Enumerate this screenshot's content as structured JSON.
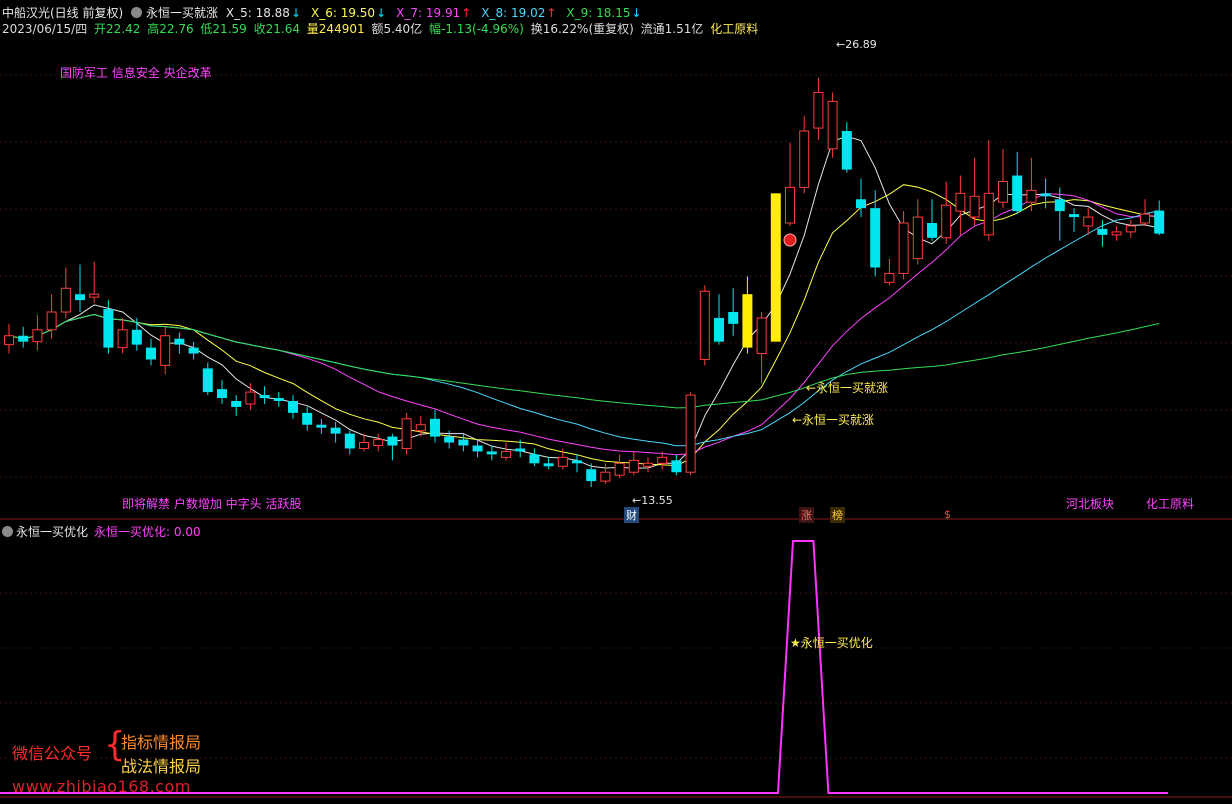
{
  "header": {
    "stock_title": "中船汉光(日线 前复权)",
    "indicator_name": "永恒一买就涨",
    "ma_items": [
      {
        "label": "X_5: 18.88",
        "arrow": "↓",
        "color": "#e6e6e6",
        "arrow_color": "#00e5ff"
      },
      {
        "label": "X_6: 19.50",
        "arrow": "↓",
        "color": "#ffff4a",
        "arrow_color": "#00e5ff"
      },
      {
        "label": "X_7: 19.91",
        "arrow": "↑",
        "color": "#ff44ff",
        "arrow_color": "#ff3030"
      },
      {
        "label": "X_8: 19.02",
        "arrow": "↑",
        "color": "#4ad8ff",
        "arrow_color": "#ff3030"
      },
      {
        "label": "X_9: 18.15",
        "arrow": "↓",
        "color": "#33dd55",
        "arrow_color": "#00e5ff"
      }
    ]
  },
  "quote": {
    "date": "2023/06/15/四",
    "open": "开22.42",
    "high": "高22.76",
    "low": "低21.59",
    "close": "收21.64",
    "volume": "量244901",
    "amount": "额5.40亿",
    "change": "幅-1.13(-4.96%)",
    "turnover": "换16.22%(重复权)",
    "float": "流通1.51亿",
    "industry": "化工原料"
  },
  "annotations": {
    "concept_top": "国防军工 信息安全 央企改革",
    "concept_bottom": "即将解禁 户数增加 中字头 活跃股",
    "region_tag": "河北板块",
    "industry_tag": "化工原料",
    "high_label": "26.89",
    "low_label": "13.55",
    "signal_1": "←永恒一买就涨",
    "signal_2": "←永恒一买就涨",
    "event_cai": "财",
    "event_zhang": "涨",
    "event_bang": "榜",
    "event_s": "$"
  },
  "sub_panel": {
    "title": "永恒一买优化",
    "value_label": "永恒一买优化: 0.00",
    "signal_text": "★永恒一买优化"
  },
  "watermark": {
    "wechat": "微信公众号",
    "line1": "指标情报局",
    "line2": "战法情报局",
    "url": "www.zhibiao168.com"
  },
  "colors": {
    "up": "#ff3d3d",
    "down": "#00e5ee",
    "limit_up": "#ffee00",
    "ma5": "#e6e6e6",
    "ma6": "#ffff4a",
    "ma7": "#ff44ff",
    "ma8": "#4ad8ff",
    "ma9": "#33dd55",
    "sub_line": "#ff33ff"
  },
  "chart_data": {
    "type": "candlestick",
    "price_range": [
      13.0,
      28.0
    ],
    "high": 26.89,
    "low": 13.55,
    "candles": [
      {
        "o": 17.9,
        "c": 18.2,
        "h": 18.6,
        "l": 17.6
      },
      {
        "o": 18.2,
        "c": 18.0,
        "h": 18.5,
        "l": 17.8
      },
      {
        "o": 18.0,
        "c": 18.4,
        "h": 18.9,
        "l": 17.7
      },
      {
        "o": 18.4,
        "c": 19.0,
        "h": 19.6,
        "l": 18.1
      },
      {
        "o": 19.0,
        "c": 19.8,
        "h": 20.5,
        "l": 18.8
      },
      {
        "o": 19.6,
        "c": 19.4,
        "h": 20.6,
        "l": 19.0
      },
      {
        "o": 19.5,
        "c": 19.6,
        "h": 20.7,
        "l": 19.3
      },
      {
        "o": 19.1,
        "c": 17.8,
        "h": 19.4,
        "l": 17.6
      },
      {
        "o": 17.8,
        "c": 18.4,
        "h": 18.8,
        "l": 17.6
      },
      {
        "o": 18.4,
        "c": 17.9,
        "h": 18.8,
        "l": 17.7
      },
      {
        "o": 17.8,
        "c": 17.4,
        "h": 18.1,
        "l": 17.2
      },
      {
        "o": 17.2,
        "c": 18.2,
        "h": 18.5,
        "l": 16.9
      },
      {
        "o": 18.1,
        "c": 17.9,
        "h": 18.3,
        "l": 17.6
      },
      {
        "o": 17.8,
        "c": 17.6,
        "h": 18.0,
        "l": 17.4
      },
      {
        "o": 17.1,
        "c": 16.3,
        "h": 17.3,
        "l": 16.2
      },
      {
        "o": 16.4,
        "c": 16.1,
        "h": 16.7,
        "l": 15.9
      },
      {
        "o": 16.0,
        "c": 15.8,
        "h": 16.2,
        "l": 15.5
      },
      {
        "o": 15.9,
        "c": 16.3,
        "h": 16.6,
        "l": 15.7
      },
      {
        "o": 16.2,
        "c": 16.1,
        "h": 16.5,
        "l": 15.9
      },
      {
        "o": 16.1,
        "c": 16.0,
        "h": 16.3,
        "l": 15.8
      },
      {
        "o": 16.0,
        "c": 15.6,
        "h": 16.2,
        "l": 15.4
      },
      {
        "o": 15.6,
        "c": 15.2,
        "h": 15.8,
        "l": 15.0
      },
      {
        "o": 15.2,
        "c": 15.1,
        "h": 15.4,
        "l": 14.9
      },
      {
        "o": 15.1,
        "c": 14.9,
        "h": 15.3,
        "l": 14.6
      },
      {
        "o": 14.9,
        "c": 14.4,
        "h": 15.0,
        "l": 14.2
      },
      {
        "o": 14.4,
        "c": 14.6,
        "h": 14.9,
        "l": 14.3
      },
      {
        "o": 14.5,
        "c": 14.7,
        "h": 14.9,
        "l": 14.3
      },
      {
        "o": 14.8,
        "c": 14.5,
        "h": 14.9,
        "l": 14.0
      },
      {
        "o": 14.4,
        "c": 15.4,
        "h": 15.6,
        "l": 14.2
      },
      {
        "o": 15.0,
        "c": 15.2,
        "h": 15.5,
        "l": 14.8
      },
      {
        "o": 15.4,
        "c": 14.8,
        "h": 15.7,
        "l": 14.6
      },
      {
        "o": 14.8,
        "c": 14.6,
        "h": 15.0,
        "l": 14.4
      },
      {
        "o": 14.7,
        "c": 14.5,
        "h": 14.9,
        "l": 14.3
      },
      {
        "o": 14.5,
        "c": 14.3,
        "h": 14.7,
        "l": 14.1
      },
      {
        "o": 14.3,
        "c": 14.2,
        "h": 14.5,
        "l": 14.0
      },
      {
        "o": 14.1,
        "c": 14.3,
        "h": 14.6,
        "l": 14.0
      },
      {
        "o": 14.4,
        "c": 14.3,
        "h": 14.7,
        "l": 14.1
      },
      {
        "o": 14.2,
        "c": 13.9,
        "h": 14.4,
        "l": 13.8
      },
      {
        "o": 13.9,
        "c": 13.8,
        "h": 14.1,
        "l": 13.7
      },
      {
        "o": 13.8,
        "c": 14.1,
        "h": 14.4,
        "l": 13.7
      },
      {
        "o": 14.0,
        "c": 13.9,
        "h": 14.2,
        "l": 13.6
      },
      {
        "o": 13.7,
        "c": 13.3,
        "h": 13.9,
        "l": 13.1
      },
      {
        "o": 13.3,
        "c": 13.6,
        "h": 13.9,
        "l": 13.2
      },
      {
        "o": 13.5,
        "c": 13.9,
        "h": 14.2,
        "l": 13.4
      },
      {
        "o": 13.6,
        "c": 14.0,
        "h": 14.3,
        "l": 13.5
      },
      {
        "o": 13.8,
        "c": 13.9,
        "h": 14.1,
        "l": 13.6
      },
      {
        "o": 13.9,
        "c": 14.1,
        "h": 14.3,
        "l": 13.7
      },
      {
        "o": 14.0,
        "c": 13.6,
        "h": 14.2,
        "l": 13.5
      },
      {
        "o": 13.6,
        "c": 16.2,
        "h": 16.3,
        "l": 13.5
      },
      {
        "o": 17.4,
        "c": 19.7,
        "h": 19.9,
        "l": 17.2
      },
      {
        "o": 18.8,
        "c": 18.0,
        "h": 19.6,
        "l": 17.9
      },
      {
        "o": 19.0,
        "c": 18.6,
        "h": 19.8,
        "l": 18.2
      },
      {
        "o": 19.6,
        "c": 17.8,
        "h": 20.2,
        "l": 17.6
      },
      {
        "o": 17.6,
        "c": 18.8,
        "h": 19.0,
        "l": 16.6
      },
      {
        "o": 18.0,
        "c": 23.0,
        "h": 23.0,
        "l": 18.0
      },
      {
        "o": 22.0,
        "c": 23.2,
        "h": 24.7,
        "l": 21.9
      },
      {
        "o": 23.2,
        "c": 25.1,
        "h": 25.6,
        "l": 23.0
      },
      {
        "o": 25.2,
        "c": 26.4,
        "h": 26.89,
        "l": 24.8
      },
      {
        "o": 24.5,
        "c": 26.1,
        "h": 26.4,
        "l": 24.2
      },
      {
        "o": 25.1,
        "c": 23.8,
        "h": 25.4,
        "l": 23.7
      },
      {
        "o": 22.8,
        "c": 22.5,
        "h": 23.5,
        "l": 22.2
      },
      {
        "o": 22.5,
        "c": 20.5,
        "h": 23.1,
        "l": 20.2
      },
      {
        "o": 20.0,
        "c": 20.3,
        "h": 20.8,
        "l": 19.9
      },
      {
        "o": 20.3,
        "c": 22.0,
        "h": 22.4,
        "l": 20.1
      },
      {
        "o": 20.8,
        "c": 22.2,
        "h": 22.8,
        "l": 20.6
      },
      {
        "o": 22.0,
        "c": 21.5,
        "h": 22.8,
        "l": 21.4
      },
      {
        "o": 21.5,
        "c": 22.6,
        "h": 23.4,
        "l": 21.3
      },
      {
        "o": 22.4,
        "c": 23.0,
        "h": 23.6,
        "l": 21.6
      },
      {
        "o": 22.2,
        "c": 22.9,
        "h": 24.2,
        "l": 21.9
      },
      {
        "o": 21.6,
        "c": 23.0,
        "h": 24.8,
        "l": 21.4
      },
      {
        "o": 22.7,
        "c": 23.4,
        "h": 24.5,
        "l": 22.5
      },
      {
        "o": 23.6,
        "c": 22.4,
        "h": 24.4,
        "l": 22.3
      },
      {
        "o": 22.7,
        "c": 23.1,
        "h": 24.2,
        "l": 22.4
      },
      {
        "o": 23.0,
        "c": 22.9,
        "h": 23.5,
        "l": 22.5
      },
      {
        "o": 22.8,
        "c": 22.4,
        "h": 23.2,
        "l": 21.4
      },
      {
        "o": 22.3,
        "c": 22.2,
        "h": 22.5,
        "l": 21.7
      },
      {
        "o": 21.9,
        "c": 22.2,
        "h": 22.5,
        "l": 21.6
      },
      {
        "o": 21.8,
        "c": 21.6,
        "h": 22.1,
        "l": 21.2
      },
      {
        "o": 21.6,
        "c": 21.7,
        "h": 21.9,
        "l": 21.4
      },
      {
        "o": 21.7,
        "c": 21.9,
        "h": 22.1,
        "l": 21.5
      },
      {
        "o": 22.0,
        "c": 22.3,
        "h": 22.8,
        "l": 21.9
      },
      {
        "o": 22.42,
        "c": 21.64,
        "h": 22.76,
        "l": 21.59
      }
    ],
    "limit_up_indices": [
      52,
      54
    ],
    "sub_signal": {
      "value": 0.0,
      "peak_start_index": 55,
      "peak_end_index": 57
    }
  }
}
